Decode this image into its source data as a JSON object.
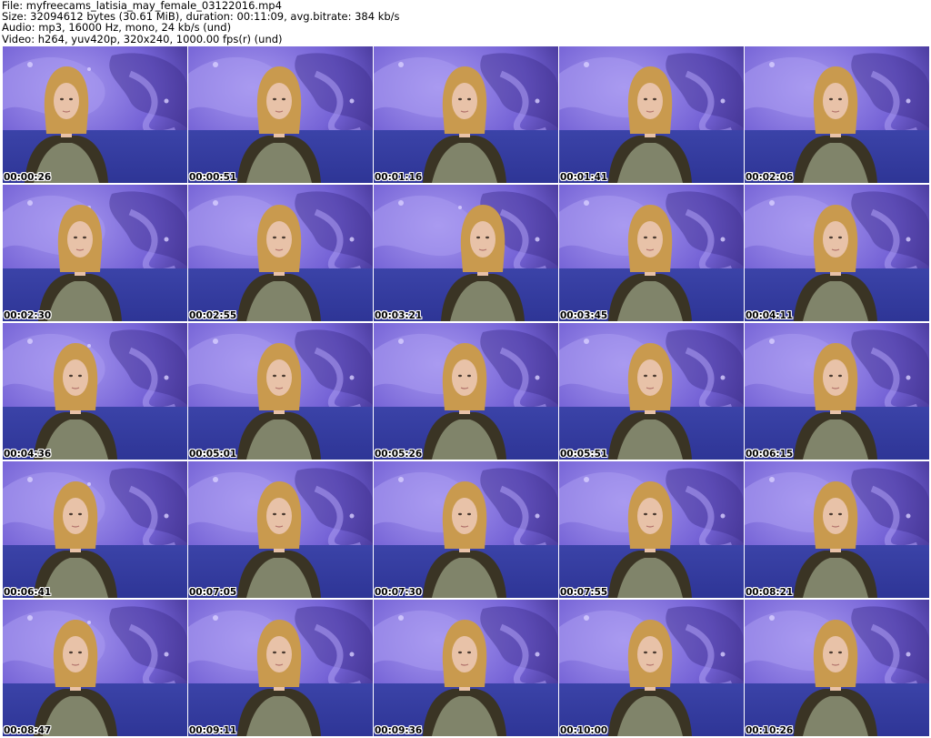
{
  "header": {
    "file_line": "File: myfreecams_latisia_may_female_03122016.mp4",
    "size_line": "Size: 32094612 bytes (30.61 MiB), duration: 00:11:09, avg.bitrate: 384 kb/s",
    "audio_line": "Audio: mp3, 16000 Hz, mono, 24 kb/s (und)",
    "video_line": "Video: h264, yuv420p, 320x240, 1000.00 fps(r) (und)"
  },
  "thumbnails": [
    {
      "timestamp": "00:00:26"
    },
    {
      "timestamp": "00:00:51"
    },
    {
      "timestamp": "00:01:16"
    },
    {
      "timestamp": "00:01:41"
    },
    {
      "timestamp": "00:02:06"
    },
    {
      "timestamp": "00:02:30"
    },
    {
      "timestamp": "00:02:55"
    },
    {
      "timestamp": "00:03:21"
    },
    {
      "timestamp": "00:03:45"
    },
    {
      "timestamp": "00:04:11"
    },
    {
      "timestamp": "00:04:36"
    },
    {
      "timestamp": "00:05:01"
    },
    {
      "timestamp": "00:05:26"
    },
    {
      "timestamp": "00:05:51"
    },
    {
      "timestamp": "00:06:15"
    },
    {
      "timestamp": "00:06:41"
    },
    {
      "timestamp": "00:07:05"
    },
    {
      "timestamp": "00:07:30"
    },
    {
      "timestamp": "00:07:55"
    },
    {
      "timestamp": "00:08:21"
    },
    {
      "timestamp": "00:08:47"
    },
    {
      "timestamp": "00:09:11"
    },
    {
      "timestamp": "00:09:36"
    },
    {
      "timestamp": "00:10:00"
    },
    {
      "timestamp": "00:10:26"
    }
  ],
  "colors": {
    "backdrop_light": "#a99af0",
    "backdrop_mid": "#7563d6",
    "backdrop_dark": "#3d2f8c",
    "couch": "#2e3596",
    "hair": "#c99a4e",
    "skin": "#e8c2a8",
    "blouse_dark": "#3a3424",
    "blouse_light": "#b9c7a4"
  }
}
